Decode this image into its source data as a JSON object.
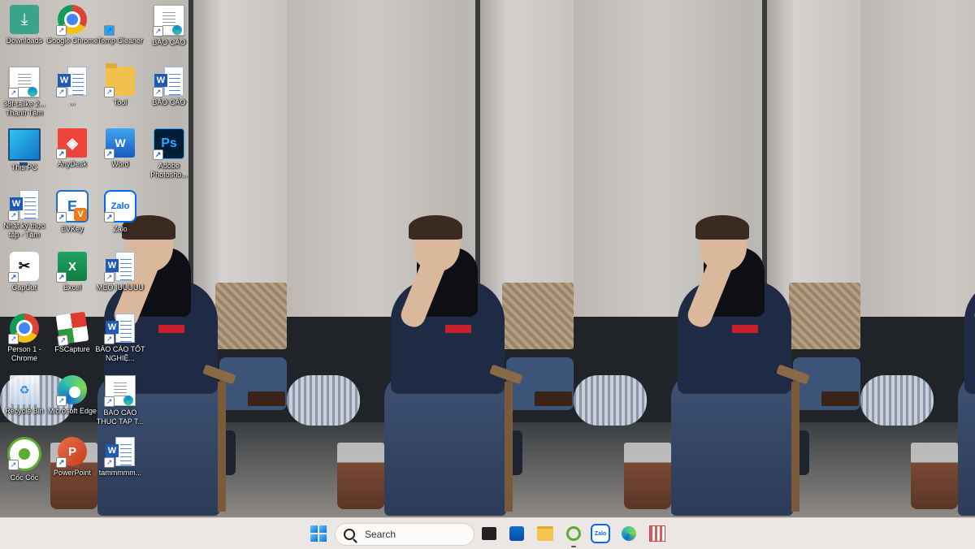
{
  "desktop": {
    "icons": [
      {
        "label": "Downloads",
        "icon": "folder-download-icon"
      },
      {
        "label": "Google Chrome",
        "icon": "chrome-icon"
      },
      {
        "label": "Temp Cleaner",
        "icon": "windows-cleaner-icon"
      },
      {
        "label": "BÁO CÁO",
        "icon": "document-edge-icon"
      },
      {
        "label": "38f-tailke 2... Thanh Tâm",
        "icon": "document-edge-icon"
      },
      {
        "label": "...",
        "icon": "word-document-icon"
      },
      {
        "label": "Tool",
        "icon": "folder-icon"
      },
      {
        "label": "BÁO CÁO",
        "icon": "word-document-icon"
      },
      {
        "label": "This PC",
        "icon": "monitor-icon"
      },
      {
        "label": "AnyDesk",
        "icon": "anydesk-icon"
      },
      {
        "label": "Word",
        "icon": "word-app-icon"
      },
      {
        "label": "Adobe Photosho...",
        "icon": "photoshop-icon"
      },
      {
        "label": "Nhật ký thực tập - Tâm",
        "icon": "word-document-icon"
      },
      {
        "label": "EVKey",
        "icon": "evkey-icon"
      },
      {
        "label": "Zalo",
        "icon": "zalo-icon"
      },
      {
        "label": "CapCut",
        "icon": "capcut-icon"
      },
      {
        "label": "Excel",
        "icon": "excel-icon"
      },
      {
        "label": "MẸO IUUUUU",
        "icon": "word-document-icon"
      },
      {
        "label": "Person 1 - Chrome",
        "icon": "chrome-profile-icon"
      },
      {
        "label": "FSCapture",
        "icon": "fscapture-icon"
      },
      {
        "label": "BÁO CÁO TỐT NGHIỆ...",
        "icon": "word-document-icon"
      },
      {
        "label": "Recycle Bin",
        "icon": "recycle-bin-icon"
      },
      {
        "label": "Microsoft Edge",
        "icon": "edge-icon"
      },
      {
        "label": "BAO CAO THUC TAP T...",
        "icon": "document-edge-icon"
      },
      {
        "label": "Cốc Cốc",
        "icon": "coccoc-icon"
      },
      {
        "label": "PowerPoint",
        "icon": "powerpoint-icon"
      },
      {
        "label": "tammmmm...",
        "icon": "word-document-icon"
      }
    ]
  },
  "taskbar": {
    "search_placeholder": "Search",
    "pinned": [
      {
        "name": "start",
        "icon": "windows-start-icon"
      },
      {
        "name": "task-view",
        "icon": "task-view-icon"
      },
      {
        "name": "microsoft-store",
        "icon": "store-icon"
      },
      {
        "name": "file-explorer",
        "icon": "file-explorer-icon"
      },
      {
        "name": "coccoc",
        "icon": "coccoc-icon",
        "running": true
      },
      {
        "name": "zalo",
        "icon": "zalo-icon",
        "label": "Zalo"
      },
      {
        "name": "edge",
        "icon": "edge-icon"
      },
      {
        "name": "snipping",
        "icon": "snipping-tool-icon"
      }
    ]
  },
  "colors": {
    "taskbar_bg": "#ece7e4",
    "accent_blue": "#0a6fd8"
  }
}
